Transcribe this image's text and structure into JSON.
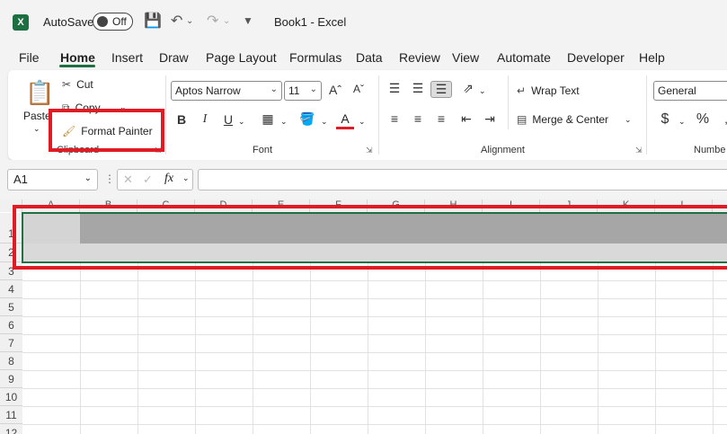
{
  "titlebar": {
    "autosave_label": "AutoSave",
    "autosave_state": "Off",
    "title": "Book1  -  Excel",
    "logo": "X"
  },
  "menu": {
    "tabs": [
      "File",
      "Home",
      "Insert",
      "Draw",
      "Page Layout",
      "Formulas",
      "Data",
      "Review",
      "View",
      "Automate",
      "Developer",
      "Help"
    ],
    "active": "Home"
  },
  "ribbon": {
    "clipboard": {
      "label": "Clipboard",
      "paste": "Paste",
      "cut": "Cut",
      "copy": "Copy",
      "format_painter": "Format Painter"
    },
    "font": {
      "label": "Font",
      "font_name": "Aptos Narrow",
      "font_size": "11",
      "bold": "B",
      "italic": "I",
      "underline": "U"
    },
    "alignment": {
      "label": "Alignment",
      "wrap_text": "Wrap Text",
      "merge_center": "Merge & Center"
    },
    "number": {
      "label": "Numbe",
      "format": "General",
      "currency": "$",
      "percent": "%"
    }
  },
  "formula_bar": {
    "name_box": "A1",
    "fx": "fx",
    "value": ""
  },
  "grid": {
    "columns": [
      "A",
      "B",
      "C",
      "D",
      "E",
      "F",
      "G",
      "H",
      "I",
      "J",
      "K",
      "L"
    ],
    "rows": [
      "1",
      "2",
      "3",
      "4",
      "5",
      "6",
      "7",
      "8",
      "9",
      "10",
      "11",
      "12"
    ]
  },
  "colors": {
    "accent": "#1d6f42",
    "highlight": "#e01b24"
  }
}
